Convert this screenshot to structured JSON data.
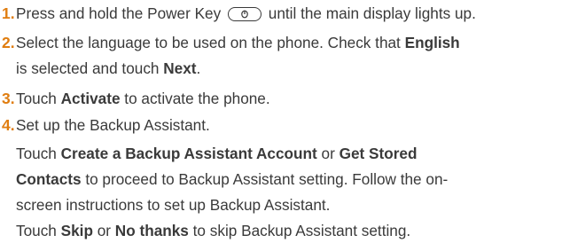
{
  "steps": [
    {
      "num": "1.",
      "parts": [
        "Press and hold the Power Key",
        "until the main display lights up."
      ],
      "icon": "power-key-icon"
    },
    {
      "num": "2.",
      "parts": [
        "Select the language to be used on the phone. Check that ",
        "English"
      ],
      "cont": [
        "is selected and touch ",
        "Next",
        "."
      ]
    },
    {
      "num": "3.",
      "parts": [
        "Touch ",
        "Activate",
        " to activate the phone."
      ]
    },
    {
      "num": "4.",
      "parts": [
        "Set up the Backup Assistant."
      ],
      "lines": [
        [
          "Touch ",
          "Create a Backup Assistant Account",
          " or ",
          "Get Stored"
        ],
        [
          "Contacts",
          " to proceed to Backup Assistant setting. Follow the on-"
        ],
        [
          "screen instructions to set up Backup Assistant."
        ],
        [
          "Touch ",
          "Skip",
          " or ",
          "No thanks",
          " to skip Backup Assistant setting."
        ]
      ]
    }
  ]
}
